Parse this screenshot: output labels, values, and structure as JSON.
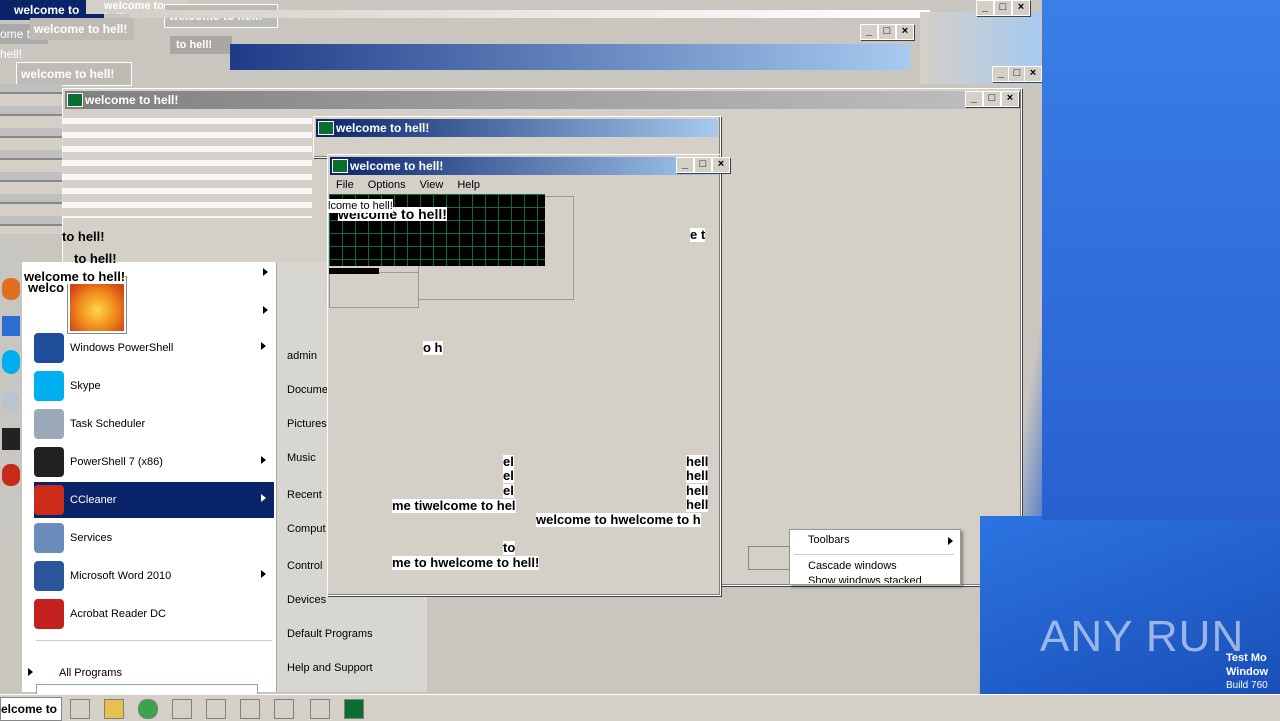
{
  "window_title": "welcome to hell!",
  "stray_titles": [
    "welcome to hell!",
    "welcome to hell!",
    "welcome to hell!",
    "ome to hell!",
    "to hell!",
    "welcome to hell!"
  ],
  "glitch_text": {
    "big_welcome": "welcome to hell!",
    "small_welcome": "lcome to hell!",
    "fragment_t": "e t",
    "fragment_h": "o h",
    "el_1": "el",
    "el_2": "el",
    "el_3": "el",
    "hel_1": "hell",
    "hel_2": "hell",
    "hel_3": "hell",
    "hel_4": "hell",
    "line_1": "me tiwelcome to hel",
    "line_2": "welcome to hwelcome to h",
    "to": "to",
    "line_3": "me to hwelcome to hell!",
    "left_welcome": "welcome to hell!",
    "left_welcome2": "welco",
    "left_hell": "to hell!",
    "left_hell2": "to hell!",
    "taskbar_fragment": "elcome to h"
  },
  "main_window": {
    "menu": [
      "File",
      "Options",
      "View",
      "Help"
    ],
    "controls": {
      "minimize": "_",
      "maximize": "□",
      "close": "×"
    }
  },
  "start_menu": {
    "items": [
      {
        "label": "Windows PowerShell",
        "icon": "powershell-icon",
        "color": "#1f4f9c",
        "submenu": true
      },
      {
        "label": "Skype",
        "icon": "skype-icon",
        "color": "#00aff0",
        "submenu": false
      },
      {
        "label": "Task Scheduler",
        "icon": "clock-icon",
        "color": "#9aa8b8",
        "submenu": false
      },
      {
        "label": "PowerShell 7 (x86)",
        "icon": "powershell7-icon",
        "color": "#222",
        "submenu": true
      },
      {
        "label": "CCleaner",
        "icon": "ccleaner-icon",
        "color": "#cc2b1a",
        "submenu": true,
        "selected": true
      },
      {
        "label": "Services",
        "icon": "services-icon",
        "color": "#6a8cbc",
        "submenu": false
      },
      {
        "label": "Microsoft Word 2010",
        "icon": "word-icon",
        "color": "#2a5699",
        "submenu": true
      },
      {
        "label": "Acrobat Reader DC",
        "icon": "acrobat-icon",
        "color": "#c4201e",
        "submenu": false
      }
    ],
    "all_programs": "All Programs",
    "right_links": [
      "admin",
      "Docume",
      "Pictures",
      "Music",
      "Recent",
      "Comput",
      "Control",
      "Devices",
      "Default Programs",
      "Help and Support"
    ],
    "highlight_color": "#0a246a"
  },
  "context_menu": {
    "items": [
      "Toolbars",
      "Cascade windows",
      "Show windows stacked"
    ]
  },
  "desktop": {
    "watermark": "ANY RUN",
    "os_text_1": "Test Mo",
    "os_text_2": "Window",
    "os_text_3": "Build 760"
  }
}
